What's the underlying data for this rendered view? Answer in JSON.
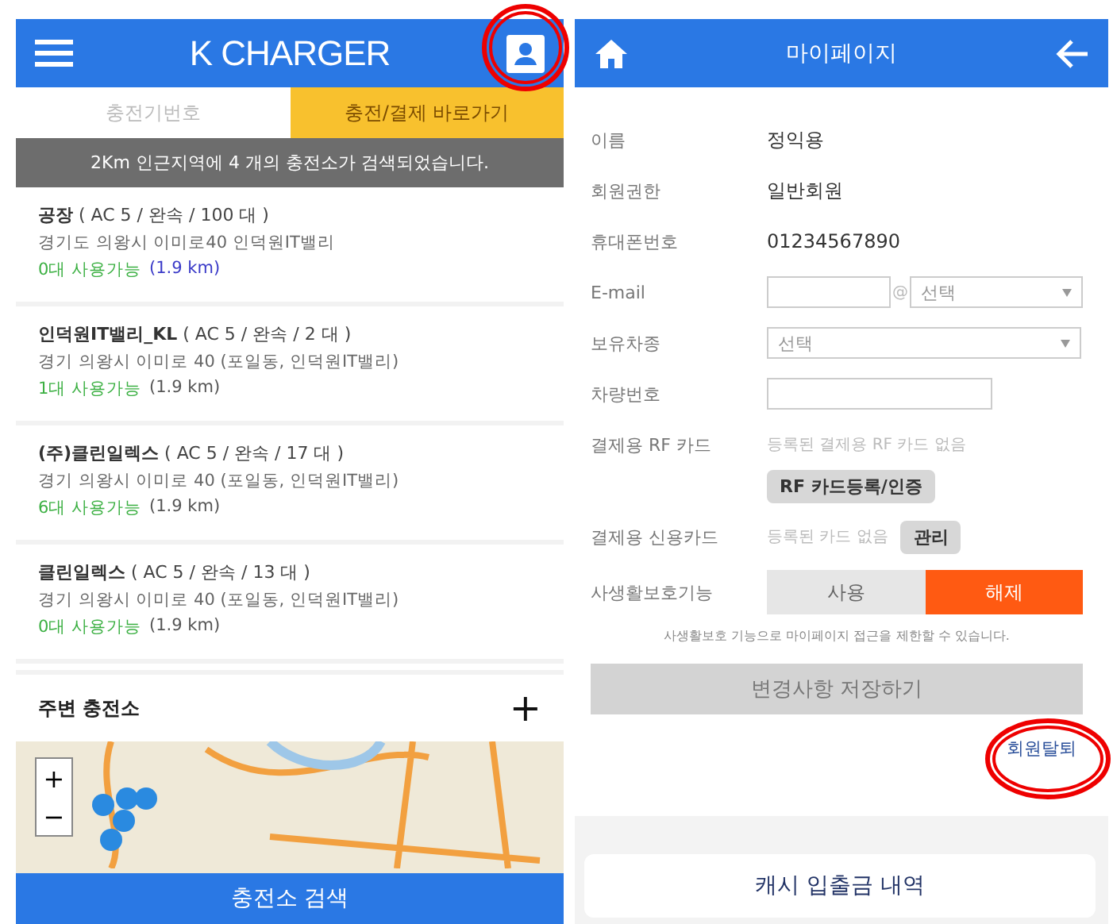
{
  "left": {
    "header": {
      "title": "K CHARGER"
    },
    "tabs": [
      {
        "label": "충전기번호",
        "selected": false
      },
      {
        "label": "충전/결제 바로가기",
        "selected": true
      }
    ],
    "banner": "2Km 인근지역에 4 개의 충전소가 검색되었습니다.",
    "stations": [
      {
        "title": "**공장** ( AC 5 / 완속 / 100 대 )",
        "address": "경기도 의왕시 이미로40 인덕원IT밸리",
        "available": "0대 사용가능",
        "distance": "(1.9 km)",
        "color": "#3a3ac8"
      },
      {
        "title": "**인덕원IT밸리_KL** ( AC 5 / 완속 / 2 대 )",
        "address": "경기 의왕시 이미로 40 (포일동, 인덕원IT밸리)",
        "available": "1대 사용가능",
        "distance": "(1.9 km)",
        "color": "#555555"
      },
      {
        "title": "**(주)클린일렉스** ( AC 5 / 완속 / 17 대 )",
        "address": "경기 의왕시 이미로 40 (포일동, 인덕원IT밸리)",
        "available": "6대 사용가능",
        "distance": "(1.9 km)",
        "color": "#555555"
      },
      {
        "title": "**클린일렉스** ( AC 5 / 완속 / 13 대 )",
        "address": "경기 의왕시 이미로 40 (포일동, 인덕원IT밸리)",
        "available": "0대 사용가능",
        "distance": "(1.9 km)",
        "color": "#555555"
      }
    ],
    "nearby": {
      "title": "주변 충전소",
      "expand": "+",
      "zoom_in": "+",
      "zoom_out": "−"
    },
    "search_button": "충전소 검색"
  },
  "right": {
    "header": {
      "title": "마이페이지"
    },
    "rows": [
      {
        "kind": "text",
        "label": "이름",
        "value": "정익용"
      },
      {
        "kind": "text",
        "label": "회원권한",
        "value": "일반회원"
      },
      {
        "kind": "text",
        "label": "휴대폰번호",
        "value": "01234567890"
      },
      {
        "kind": "email",
        "label": "E-mail",
        "at": "@",
        "domain": "선택"
      },
      {
        "kind": "select",
        "label": "보유차종",
        "placeholder": "선택"
      },
      {
        "kind": "input",
        "label": "차량번호"
      },
      {
        "kind": "note",
        "label": "결제용 RF 카드",
        "note": "등록된 결제용 RF 카드 없음"
      },
      {
        "kind": "button",
        "button": "RF 카드등록/인증"
      },
      {
        "kind": "note",
        "label": "결제용 신용카드",
        "note": "등록된 카드 없음",
        "button": "관리"
      },
      {
        "kind": "toggle",
        "label": "사생활보호기능",
        "options": [
          {
            "label": "사용",
            "selected": false
          },
          {
            "label": "해제",
            "selected": true
          }
        ]
      }
    ],
    "notice": "사생활보호 기능으로 마이페이지 접근을 제한할 수 있습니다.",
    "save_button": {
      "label": "변경사항 저장하기",
      "disabled": true
    },
    "withdraw_link": "회원탈퇴",
    "cash_button": "캐시 입출금 내역"
  }
}
